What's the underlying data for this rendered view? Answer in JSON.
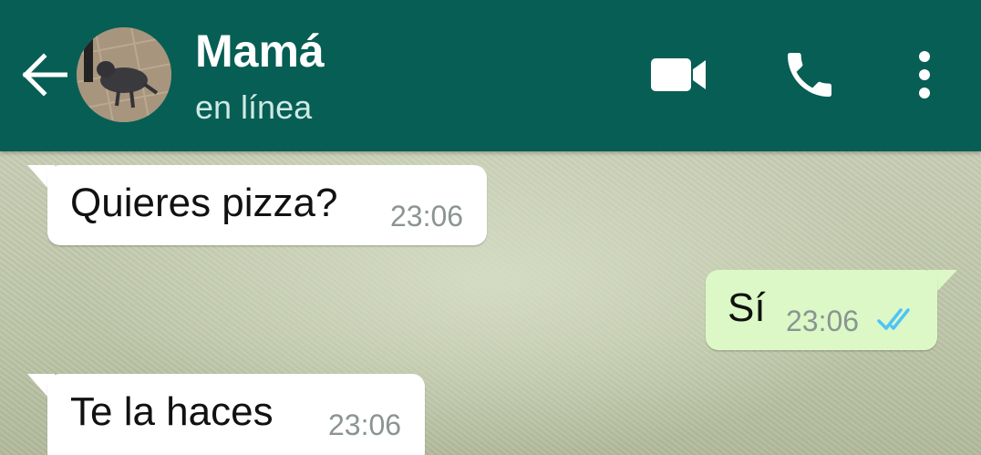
{
  "header": {
    "contact_name": "Mamá",
    "status": "en línea",
    "icons": {
      "back": "arrow-left-icon",
      "video": "video-call-icon",
      "call": "phone-icon",
      "menu": "more-vert-icon"
    },
    "color": "#075e54"
  },
  "messages": [
    {
      "direction": "in",
      "text": "Quieres pizza?",
      "time": "23:06"
    },
    {
      "direction": "out",
      "text": "Sí",
      "time": "23:06",
      "status": "read",
      "status_icon": "double-check-icon",
      "status_color": "#4fc3f7"
    },
    {
      "direction": "in",
      "text": "Te la haces",
      "time": "23:06"
    }
  ],
  "colors": {
    "incoming_bubble": "#ffffff",
    "outgoing_bubble": "#dcf8c6"
  }
}
